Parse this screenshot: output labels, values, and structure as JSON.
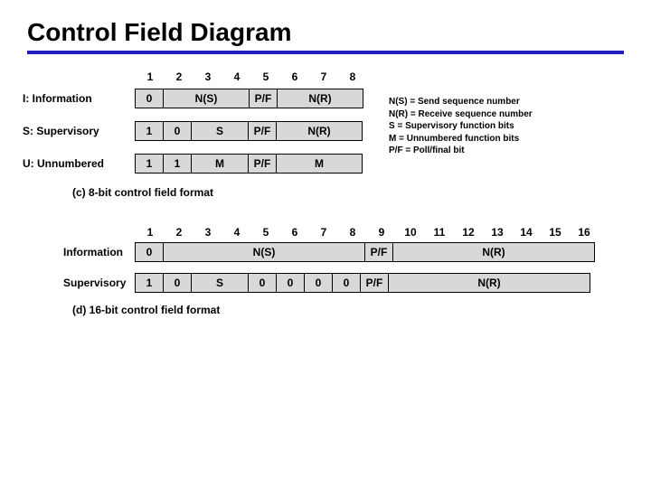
{
  "title": "Control Field Diagram",
  "section8": {
    "bit_numbers": [
      "1",
      "2",
      "3",
      "4",
      "5",
      "6",
      "7",
      "8"
    ],
    "rows": [
      {
        "label": "I: Information",
        "cells": [
          {
            "w": 1,
            "t": "0"
          },
          {
            "w": 3,
            "t": "N(S)"
          },
          {
            "w": 1,
            "t": "P/F"
          },
          {
            "w": 3,
            "t": "N(R)"
          }
        ]
      },
      {
        "label": "S: Supervisory",
        "cells": [
          {
            "w": 1,
            "t": "1"
          },
          {
            "w": 1,
            "t": "0"
          },
          {
            "w": 2,
            "t": "S"
          },
          {
            "w": 1,
            "t": "P/F"
          },
          {
            "w": 3,
            "t": "N(R)"
          }
        ]
      },
      {
        "label": "U: Unnumbered",
        "cells": [
          {
            "w": 1,
            "t": "1"
          },
          {
            "w": 1,
            "t": "1"
          },
          {
            "w": 2,
            "t": "M"
          },
          {
            "w": 1,
            "t": "P/F"
          },
          {
            "w": 3,
            "t": "M"
          }
        ]
      }
    ],
    "caption": "(c) 8-bit control field format"
  },
  "legend": [
    "N(S) = Send sequence number",
    "N(R) = Receive sequence number",
    "S = Supervisory function bits",
    "M = Unnumbered function bits",
    "P/F = Poll/final bit"
  ],
  "section16": {
    "bit_numbers": [
      "1",
      "2",
      "3",
      "4",
      "5",
      "6",
      "7",
      "8",
      "9",
      "10",
      "11",
      "12",
      "13",
      "14",
      "15",
      "16"
    ],
    "rows": [
      {
        "label": "Information",
        "cells": [
          {
            "w": 1,
            "t": "0"
          },
          {
            "w": 7,
            "t": "N(S)"
          },
          {
            "w": 1,
            "t": "P/F"
          },
          {
            "w": 7,
            "t": "N(R)"
          }
        ]
      },
      {
        "label": "Supervisory",
        "cells": [
          {
            "w": 1,
            "t": "1"
          },
          {
            "w": 1,
            "t": "0"
          },
          {
            "w": 2,
            "t": "S"
          },
          {
            "w": 1,
            "t": "0"
          },
          {
            "w": 1,
            "t": "0"
          },
          {
            "w": 1,
            "t": "0"
          },
          {
            "w": 1,
            "t": "0"
          },
          {
            "w": 1,
            "t": "P/F"
          },
          {
            "w": 7,
            "t": "N(R)"
          }
        ]
      }
    ],
    "caption": "(d) 16-bit control field format"
  }
}
